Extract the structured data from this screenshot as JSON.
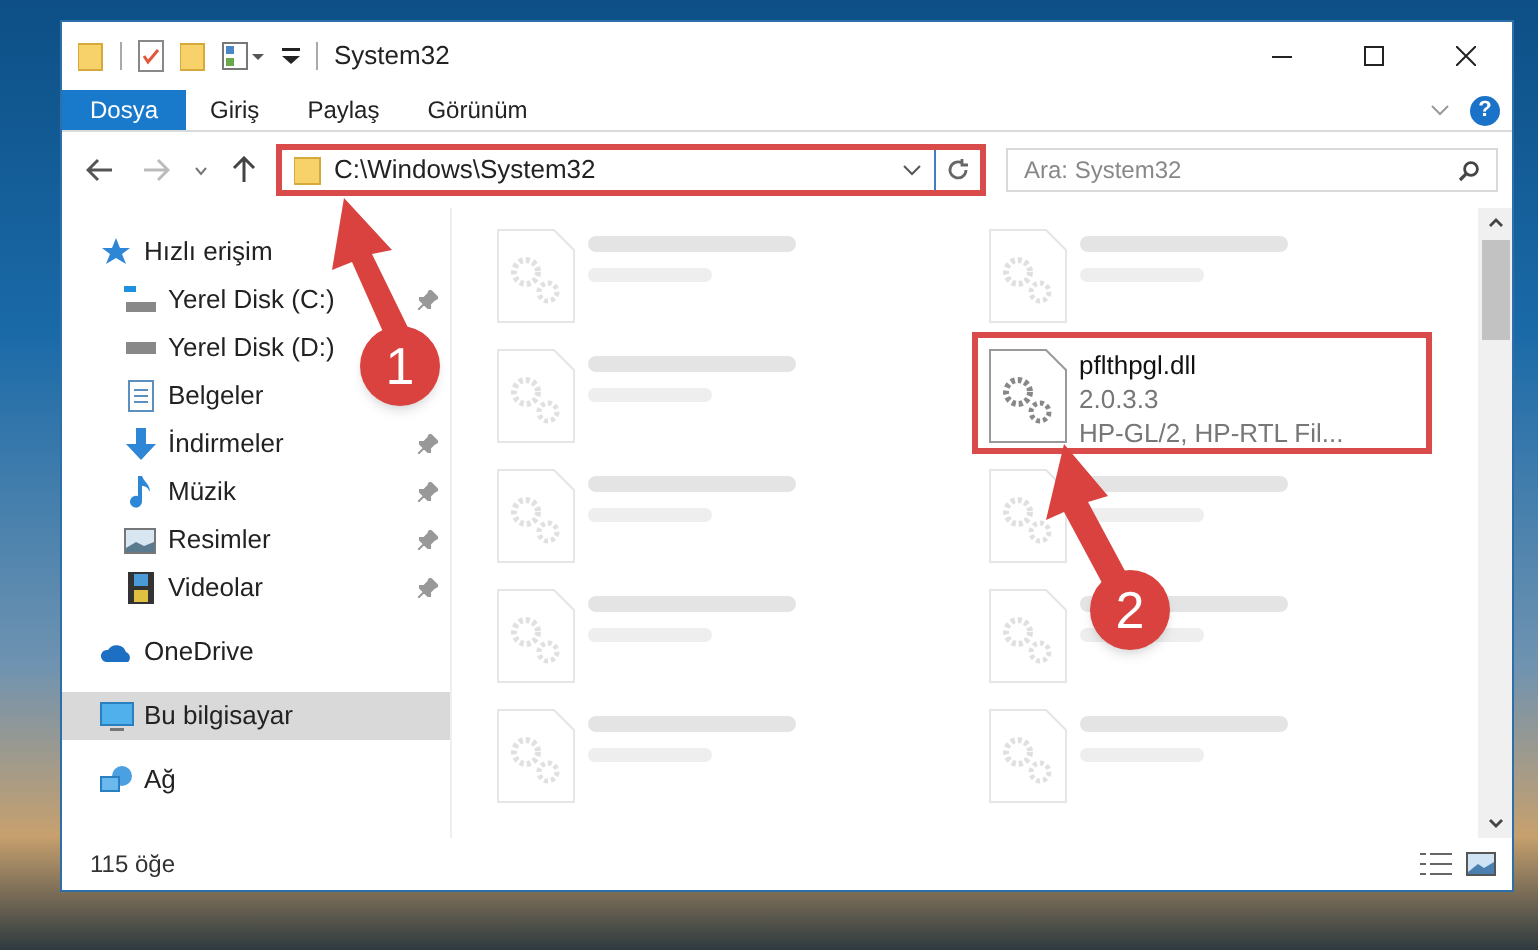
{
  "window": {
    "title": "System32"
  },
  "ribbon": {
    "tabs": [
      {
        "label": "Dosya",
        "selected": true
      },
      {
        "label": "Giriş",
        "selected": false
      },
      {
        "label": "Paylaş",
        "selected": false
      },
      {
        "label": "Görünüm",
        "selected": false
      }
    ],
    "help": "?"
  },
  "address_bar": {
    "path": "C:\\Windows\\System32",
    "search_placeholder": "Ara: System32"
  },
  "sidebar": {
    "items": [
      {
        "label": "Hızlı erişim",
        "selected": false,
        "children": [
          {
            "label": "Yerel Disk (C:)",
            "selected": false,
            "pinned": true
          },
          {
            "label": "Yerel Disk (D:)",
            "selected": false,
            "pinned": false
          },
          {
            "label": "Belgeler",
            "selected": false,
            "pinned": false
          },
          {
            "label": "İndirmeler",
            "selected": false,
            "pinned": true
          },
          {
            "label": "Müzik",
            "selected": false,
            "pinned": true
          },
          {
            "label": "Resimler",
            "selected": false,
            "pinned": true
          },
          {
            "label": "Videolar",
            "selected": false,
            "pinned": true
          }
        ]
      },
      {
        "label": "OneDrive",
        "selected": false
      },
      {
        "label": "Bu bilgisayar",
        "selected": true
      },
      {
        "label": "Ağ",
        "selected": false
      }
    ]
  },
  "files": [
    {
      "blurred": true
    },
    {
      "blurred": true
    },
    {
      "blurred": true
    },
    {
      "name": "pflthpgl.dll",
      "details": [
        "2.0.3.3",
        "HP-GL/2, HP-RTL Fil..."
      ],
      "blurred": false
    },
    {
      "blurred": true
    },
    {
      "blurred": true
    },
    {
      "blurred": true
    },
    {
      "blurred": true
    },
    {
      "blurred": true
    },
    {
      "blurred": true
    }
  ],
  "status_bar": {
    "item_count": "115 öğe"
  },
  "annotations": [
    {
      "number": "1"
    },
    {
      "number": "2"
    }
  ]
}
